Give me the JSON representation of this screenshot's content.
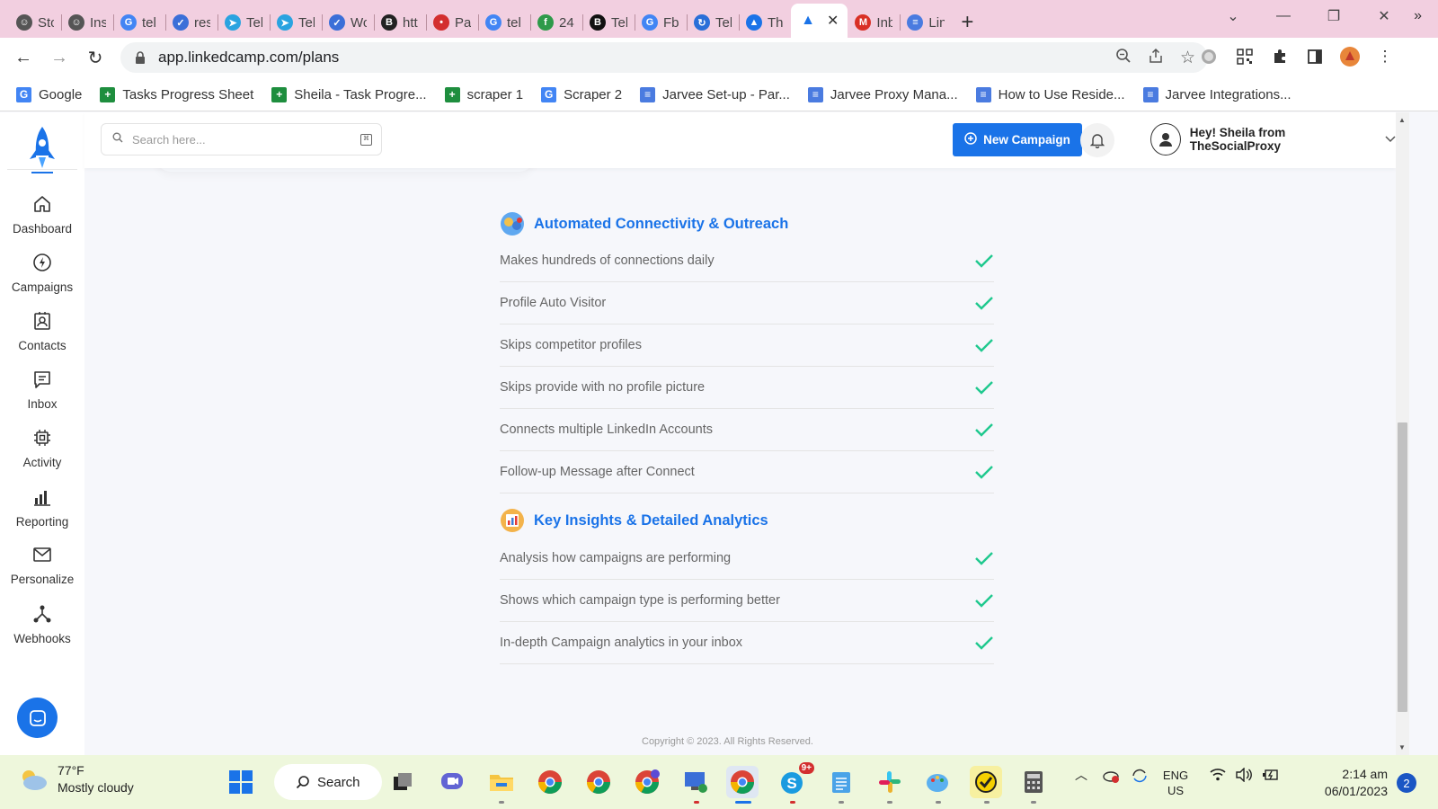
{
  "browser": {
    "tabs": [
      {
        "label": "Sto",
        "color": "#555555",
        "glyph": "☺"
      },
      {
        "label": "Ins",
        "color": "#555555",
        "glyph": "☺"
      },
      {
        "label": "tel",
        "color": "#4285f4",
        "glyph": "G"
      },
      {
        "label": "res",
        "color": "#3b6fd8",
        "glyph": "✓"
      },
      {
        "label": "Tel",
        "color": "#2aa3e0",
        "glyph": "➤"
      },
      {
        "label": "Tel",
        "color": "#2aa3e0",
        "glyph": "➤"
      },
      {
        "label": "Wo",
        "color": "#3b6fd8",
        "glyph": "✓"
      },
      {
        "label": "htt",
        "color": "#222222",
        "glyph": "B"
      },
      {
        "label": "Pas",
        "color": "#d32f2f",
        "glyph": "•"
      },
      {
        "label": "tel",
        "color": "#4285f4",
        "glyph": "G"
      },
      {
        "label": "24",
        "color": "#2e9a4a",
        "glyph": "f"
      },
      {
        "label": "Tel",
        "color": "#111111",
        "glyph": "B"
      },
      {
        "label": "Fb",
        "color": "#4285f4",
        "glyph": "G"
      },
      {
        "label": "Tel",
        "color": "#2a6fd8",
        "glyph": "↻"
      },
      {
        "label": "Th",
        "color": "#1a73e8",
        "glyph": "▲"
      }
    ],
    "active_tab": {
      "label": "",
      "color": "#1a73e8",
      "glyph": "▲"
    },
    "tabs_after": [
      {
        "label": "Inb",
        "color": "#d93025",
        "glyph": "M"
      },
      {
        "label": "Lin",
        "color": "#4a7be0",
        "glyph": "≡"
      }
    ],
    "url": "app.linkedcamp.com/plans",
    "bookmarks": [
      {
        "label": "Google",
        "color": "#4285f4",
        "glyph": "G"
      },
      {
        "label": "Tasks Progress Sheet",
        "color": "#1e8e3e",
        "glyph": "+"
      },
      {
        "label": "Sheila - Task Progre...",
        "color": "#1e8e3e",
        "glyph": "+"
      },
      {
        "label": "scraper 1",
        "color": "#1e8e3e",
        "glyph": "+"
      },
      {
        "label": "Scraper 2",
        "color": "#4285f4",
        "glyph": "G"
      },
      {
        "label": "Jarvee Set-up - Par...",
        "color": "#4a7be0",
        "glyph": "≡"
      },
      {
        "label": "Jarvee Proxy Mana...",
        "color": "#4a7be0",
        "glyph": "≡"
      },
      {
        "label": "How to Use Reside...",
        "color": "#4a7be0",
        "glyph": "≡"
      },
      {
        "label": "Jarvee Integrations...",
        "color": "#4a7be0",
        "glyph": "≡"
      }
    ]
  },
  "sidebar": {
    "items": [
      {
        "label": "Dashboard",
        "icon": "home-icon"
      },
      {
        "label": "Campaigns",
        "icon": "bolt-icon"
      },
      {
        "label": "Contacts",
        "icon": "contacts-icon"
      },
      {
        "label": "Inbox",
        "icon": "inbox-icon"
      },
      {
        "label": "Activity",
        "icon": "activity-icon"
      },
      {
        "label": "Reporting",
        "icon": "reporting-icon"
      },
      {
        "label": "Personalize",
        "icon": "mail-icon"
      },
      {
        "label": "Webhooks",
        "icon": "webhooks-icon"
      }
    ]
  },
  "header": {
    "search_placeholder": "Search here...",
    "new_campaign_label": "New Campaign",
    "user_greeting": "Hey! Sheila from TheSocialProxy"
  },
  "sections": [
    {
      "title": "Automated Connectivity & Outreach",
      "features": [
        "Makes hundreds of connections daily",
        "Profile Auto Visitor",
        "Skips competitor profiles",
        "Skips provide with no profile picture",
        "Connects multiple LinkedIn Accounts",
        "Follow-up Message after Connect"
      ]
    },
    {
      "title": "Key Insights & Detailed Analytics",
      "features": [
        "Analysis how campaigns are performing",
        "Shows which campaign type is performing better",
        "In-depth Campaign analytics in your inbox"
      ]
    }
  ],
  "footer_peek": "Copyright © 2023. All Rights Reserved.",
  "taskbar": {
    "temperature": "77°F",
    "weather": "Mostly cloudy",
    "search_label": "Search",
    "language": "ENG",
    "region": "US",
    "time": "2:14 am",
    "date": "06/01/2023",
    "notification_count": "2",
    "skype_badge": "9+"
  },
  "colors": {
    "accent": "#1a73e8",
    "check": "#1fc98e",
    "tabstrip": "#f2cfe0",
    "taskbar": "#eef7dc"
  }
}
